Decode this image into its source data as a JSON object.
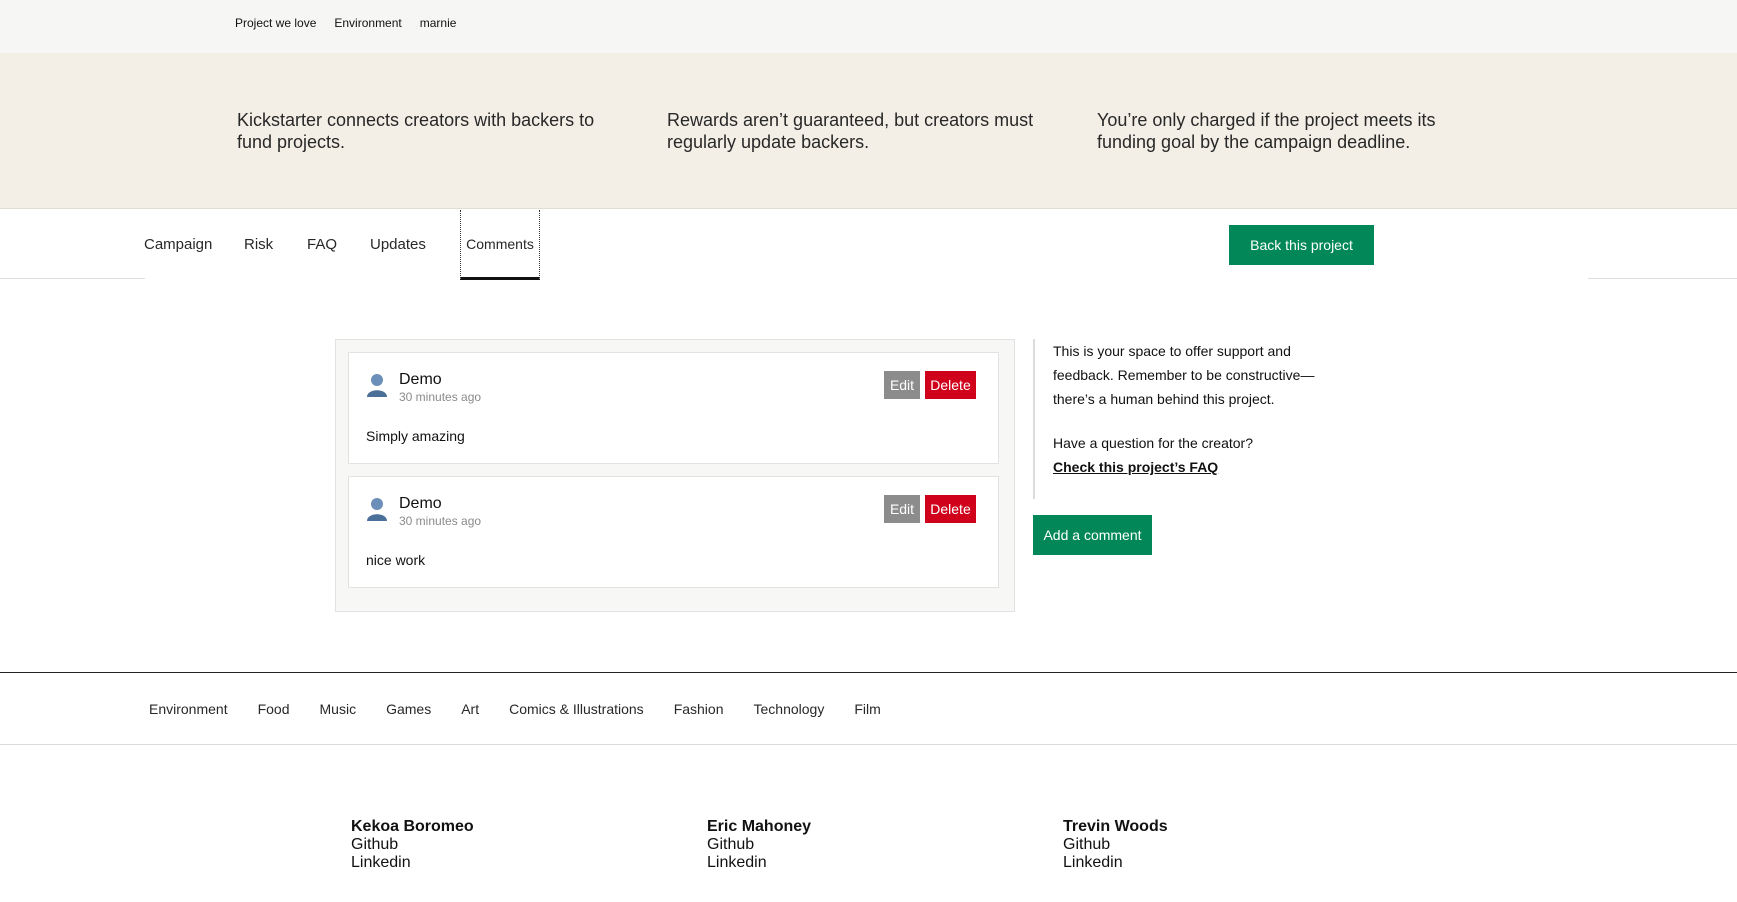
{
  "breadcrumbs": [
    "Project we love",
    "Environment",
    "marnie"
  ],
  "hero": [
    "Kickstarter connects creators with backers to fund projects.",
    "Rewards aren’t guaranteed, but creators must regularly update backers.",
    "You’re only charged if the project meets its funding goal by the campaign deadline."
  ],
  "tabs": {
    "campaign": "Campaign",
    "risk": "Risk",
    "faq": "FAQ",
    "updates": "Updates",
    "comments": "Comments",
    "back_label": "Back this project"
  },
  "comments": [
    {
      "author": "Demo",
      "time": "30 minutes ago",
      "body": "Simply amazing",
      "edit": "Edit",
      "delete": "Delete"
    },
    {
      "author": "Demo",
      "time": "30 minutes ago",
      "body": "nice work",
      "edit": "Edit",
      "delete": "Delete"
    }
  ],
  "sidebar": {
    "intro": "This is your space to offer support and feedback. Remember to be constructive—there’s a human behind this project.",
    "question": "Have a question for the creator?",
    "faq_link": "Check this project’s FAQ",
    "add_comment": "Add a comment"
  },
  "categories": [
    "Environment",
    "Food",
    "Music",
    "Games",
    "Art",
    "Comics & Illustrations",
    "Fashion",
    "Technology",
    "Film"
  ],
  "team": [
    {
      "name": "Kekoa Boromeo",
      "github": "Github",
      "linkedin": "Linkedin"
    },
    {
      "name": "Eric Mahoney",
      "github": "Github",
      "linkedin": "Linkedin"
    },
    {
      "name": "Trevin Woods",
      "github": "Github",
      "linkedin": "Linkedin"
    }
  ],
  "colors": {
    "accent": "#028858",
    "danger": "#d0021b",
    "edit": "#8c8c8c",
    "hero_bg": "#f3efe6"
  }
}
